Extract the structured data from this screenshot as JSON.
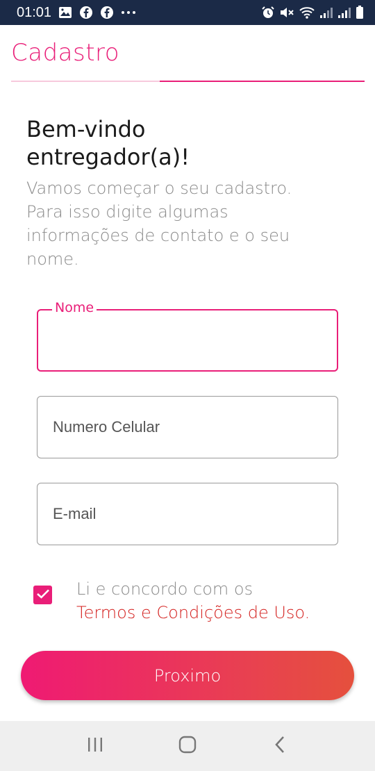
{
  "status_bar": {
    "time": "01:01",
    "left_icons": [
      "gallery-icon",
      "facebook-icon",
      "facebook-icon",
      "more-dots-icon"
    ],
    "right_icons": [
      "alarm-icon",
      "mute-icon",
      "wifi-icon",
      "signal-icon",
      "signal-icon",
      "battery-icon"
    ]
  },
  "header": {
    "title": "Cadastro",
    "progress": 0.58
  },
  "welcome": {
    "title_line1": "Bem-vindo",
    "title_line2": "entregador(a)!",
    "subtitle_line1": "Vamos começar o seu cadastro.",
    "subtitle_line2": "Para isso digite algumas",
    "subtitle_line3": "informações de contato e o seu",
    "subtitle_line4": "nome."
  },
  "form": {
    "name_label": "Nome",
    "name_value": "",
    "phone_placeholder": "Numero Celular",
    "email_placeholder": "E-mail"
  },
  "terms": {
    "checked": true,
    "text": "Li e concordo com os",
    "link": "Termos e Condições de Uso."
  },
  "actions": {
    "next_label": "Proximo"
  },
  "colors": {
    "accent": "#e91e78",
    "link": "#d4211f",
    "status_bar": "#1b2a47"
  }
}
